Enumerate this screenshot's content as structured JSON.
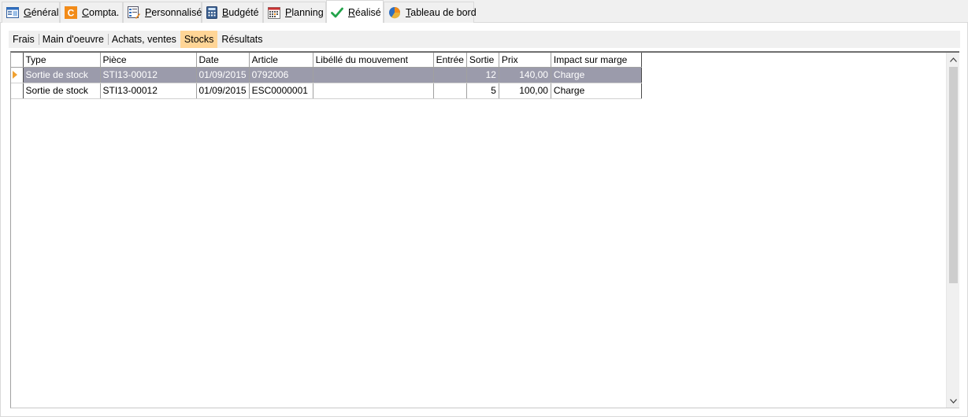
{
  "tabs": [
    {
      "label": "Général",
      "icon": "window-icon",
      "active": false
    },
    {
      "label": "Compta.",
      "icon": "c-letter-icon",
      "active": false
    },
    {
      "label": "Personnalisé",
      "icon": "custom-form-icon",
      "active": false
    },
    {
      "label": "Budgété",
      "icon": "calculator-icon",
      "active": false
    },
    {
      "label": "Planning",
      "icon": "calendar-icon",
      "active": false
    },
    {
      "label": "Réalisé",
      "icon": "checkmark-icon",
      "active": true
    },
    {
      "label": "Tableau de bord",
      "icon": "pie-chart-icon",
      "active": false
    }
  ],
  "subtabs": [
    {
      "label": "Frais",
      "active": false
    },
    {
      "label": "Main d'oeuvre",
      "active": false
    },
    {
      "label": "Achats, ventes",
      "active": false
    },
    {
      "label": "Stocks",
      "active": true
    },
    {
      "label": "Résultats",
      "active": false
    }
  ],
  "grid": {
    "columns": [
      "Type",
      "Pièce",
      "Date",
      "Article",
      "Libéllé du mouvement",
      "Entrée",
      "Sortie",
      "Prix",
      "Impact sur marge"
    ],
    "rows": [
      {
        "type": "Sortie de stock",
        "piece": "STI13-00012",
        "date": "01/09/2015",
        "article": "0792006",
        "libelle": "",
        "entree": "",
        "sortie": "12",
        "prix": "140,00",
        "impact": "Charge",
        "selected": true
      },
      {
        "type": "Sortie de stock",
        "piece": "STI13-00012",
        "date": "01/09/2015",
        "article": "ESC0000001",
        "libelle": "",
        "entree": "",
        "sortie": "5",
        "prix": "100,00",
        "impact": "Charge",
        "selected": false
      }
    ]
  },
  "colors": {
    "selected_row": "#9b9bab",
    "active_subtab": "#ffd596",
    "row_indicator": "#f0a030"
  }
}
